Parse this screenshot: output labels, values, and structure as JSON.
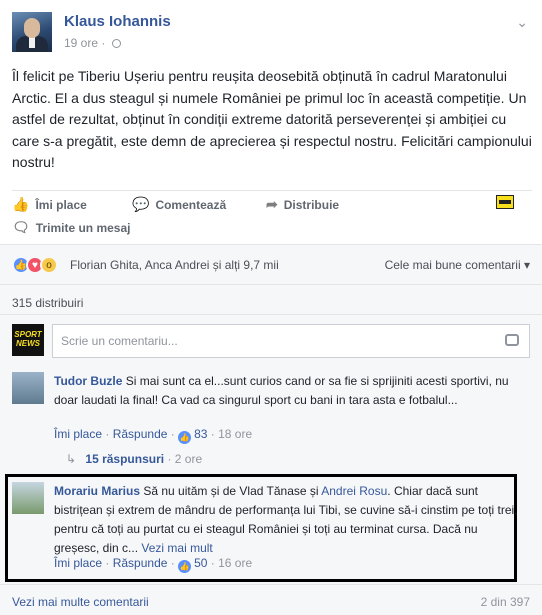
{
  "post": {
    "author": "Klaus Iohannis",
    "time": "19 ore",
    "separator": "·",
    "text": "Îl felicit pe Tiberiu Ușeriu pentru reușita deosebită obținută în cadrul Maratonului Arctic. El a dus steagul și numele României pe primul loc în această competiție. Un astfel de rezultat, obținut în condiții extreme datorită perseverenței și ambiției cu care s-a pregătit, este demn de aprecierea și respectul nostru. Felicitări campionului nostru!"
  },
  "actions": {
    "like": "Îmi place",
    "comment": "Comentează",
    "share": "Distribuie",
    "message": "Trimite un mesaj"
  },
  "reactions": {
    "names": "Florian Ghita, Anca Andrei și alți 9,7 mii",
    "sort": "Cele mai bune comentarii ▾"
  },
  "shares": "315 distribuiri",
  "composer": {
    "placeholder": "Scrie un comentariu...",
    "logo_text": "SPORT NEWS"
  },
  "comments": [
    {
      "name": "Tudor Buzle",
      "text": " Si mai sunt ca el...sunt curios cand or sa fie si sprijiniti acesti sportivi, nu doar laudati la final! Ca vad ca singurul sport cu bani in tara asta e fotbalul...",
      "like": "Îmi place",
      "reply": "Răspunde",
      "likes": "83",
      "time": "18 ore",
      "replies": "15 răspunsuri",
      "replies_time": "2 ore"
    },
    {
      "name": "Morariu Marius",
      "text_a": " Să nu uităm și de Vlad Tănase și ",
      "mention": "Andrei Rosu",
      "text_b": ". Chiar dacă sunt bistrițean și extrem de mândru de performanța lui Tibi, se cuvine să-i cinstim pe toți trei, pentru că toți au purtat cu ei steagul României și toți au terminat cursa. Dacă nu greșesc, din c...",
      "see_more": "Vezi mai mult",
      "like": "Îmi place",
      "reply": "Răspunde",
      "likes": "50",
      "time": "16 ore"
    }
  ],
  "footer": {
    "more": "Vezi mai multe comentarii",
    "count": "2 din 397"
  }
}
